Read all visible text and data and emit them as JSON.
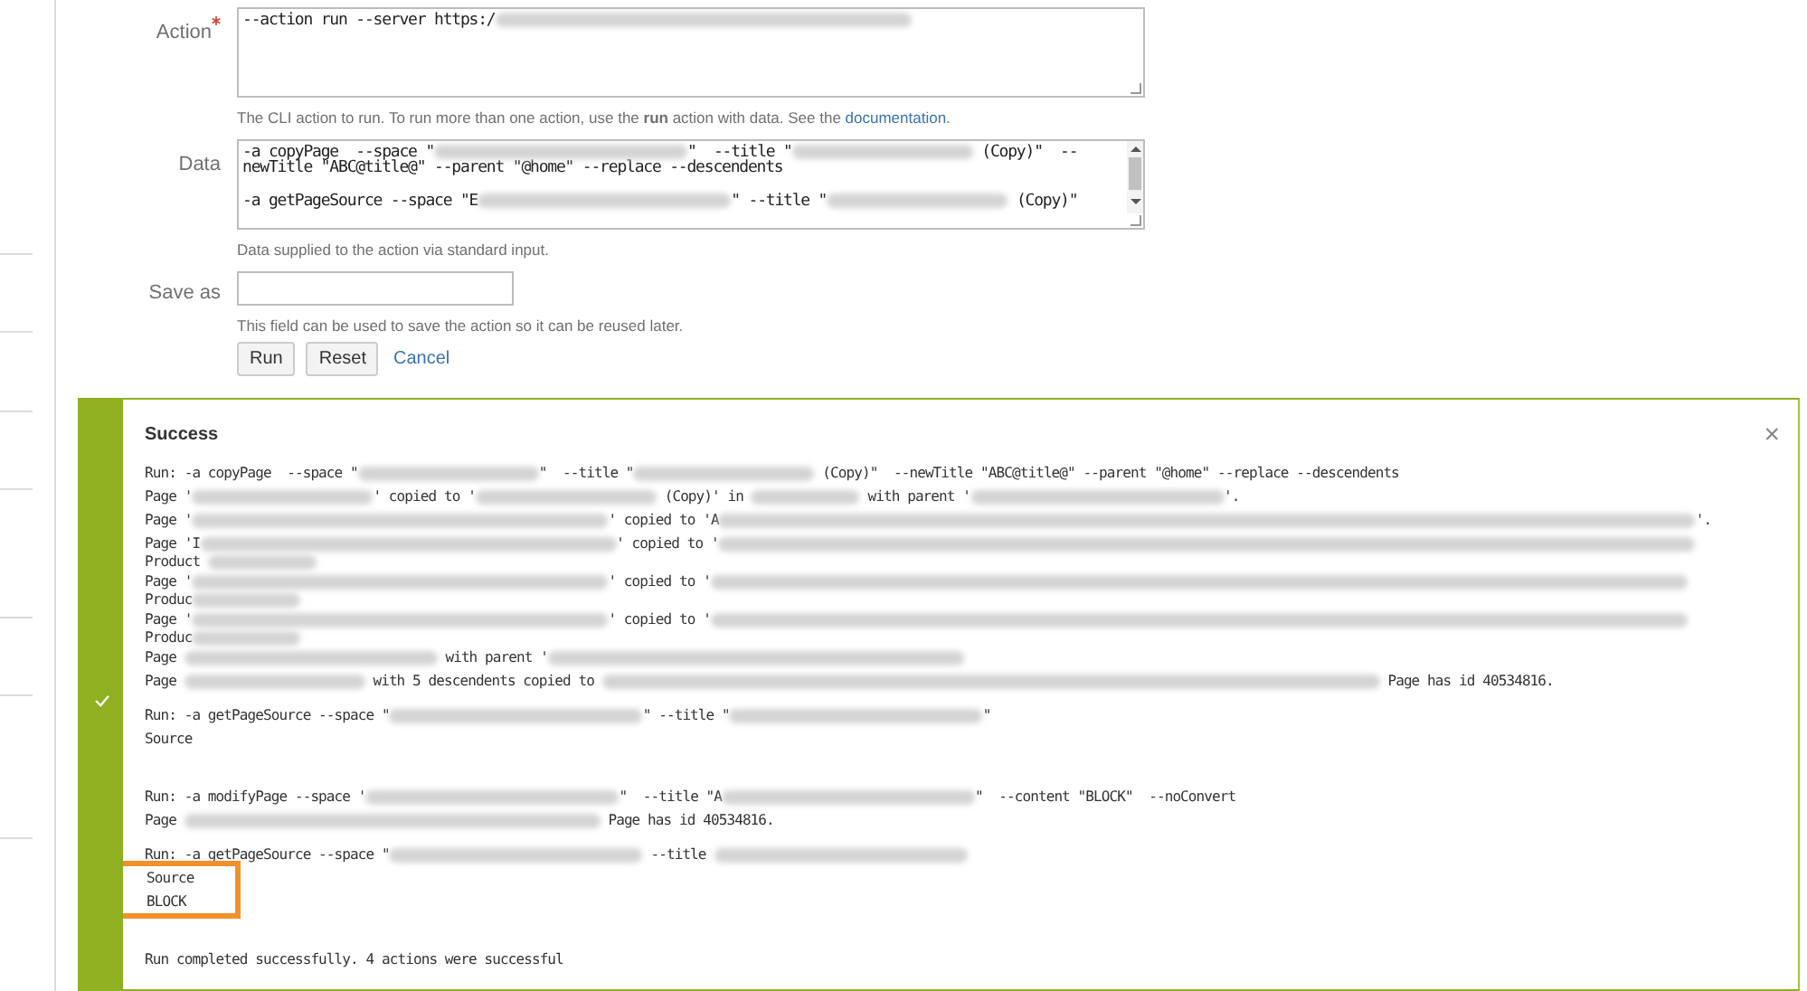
{
  "form": {
    "fields": [
      {
        "kind": "textarea",
        "label": "Action",
        "required": true,
        "lines": [
          {
            "segments": [
              "--action run --server https:/",
              {
                "kind": "blur-xl"
              }
            ]
          }
        ],
        "hint": "The CLI action to run. To run more than one action, use the **run** action with data. See the ",
        "hint_link": "documentation",
        "hint_end": "."
      },
      {
        "kind": "textarea",
        "label": "Data",
        "required": false,
        "scrollbar": true,
        "lines": [
          {
            "segments": [
              "-a copyPage  --space \"",
              {
                "kind": "blur-l"
              },
              "\"  --title \"",
              {
                "kind": "blur-m"
              },
              " (Copy)\"  --"
            ]
          },
          {
            "segments": [
              "newTitle \"ABC@title@\" --parent \"@home\" --replace --descendents"
            ]
          },
          {
            "kind": "blank"
          },
          {
            "segments": [
              "-a getPageSource --space \"E",
              {
                "kind": "blur-l"
              },
              "\" --title \"",
              {
                "kind": "blur-m"
              },
              " (Copy)\""
            ]
          }
        ],
        "hint": "Data supplied to the action via standard input."
      },
      {
        "kind": "input",
        "label": "Save as",
        "required": false,
        "hint": "This field can be used to save the action so it can be reused later."
      }
    ],
    "buttons": [
      {
        "kind": "button",
        "label": "Run"
      },
      {
        "kind": "button",
        "label": "Reset"
      },
      {
        "kind": "link",
        "label": "Cancel"
      }
    ]
  },
  "result": {
    "kind": "success",
    "title": "Success",
    "close": "×",
    "blocks": [
      {
        "lines": [
          {
            "segments": [
              "Run: -a copyPage  --space \"",
              {
                "kind": "blur-m"
              },
              "\"  --title \"",
              {
                "kind": "blur-m"
              },
              " (Copy)\"  --newTitle \"ABC@title@\" --parent \"@home\" --replace --descendents"
            ]
          },
          {
            "segments": [
              "Page '",
              {
                "kind": "blur-m"
              },
              "' copied to '",
              {
                "kind": "blur-m"
              },
              " (Copy)' in ",
              {
                "kind": "blur-s"
              },
              " with parent '",
              {
                "kind": "blur-l"
              },
              "'."
            ]
          },
          {
            "segments": [
              "Page '",
              {
                "kind": "blur-xl"
              },
              "' copied to 'A",
              {
                "kind": "blur-max"
              },
              "'."
            ]
          },
          {
            "segments": [
              "Page 'I",
              {
                "kind": "blur-xl"
              },
              "' copied to '",
              {
                "kind": "blur-max"
              }
            ],
            "wrap": [
              "Product ",
              {
                "kind": "blur-s"
              }
            ]
          },
          {
            "segments": [
              "Page '",
              {
                "kind": "blur-xl"
              },
              "' copied to '",
              {
                "kind": "blur-max"
              }
            ],
            "wrap": [
              "Produc",
              {
                "kind": "blur-s"
              }
            ]
          },
          {
            "segments": [
              "Page '",
              {
                "kind": "blur-xl"
              },
              "' copied to '",
              {
                "kind": "blur-max"
              }
            ],
            "wrap": [
              "Produc",
              {
                "kind": "blur-s"
              }
            ]
          },
          {
            "segments": [
              "Page ",
              {
                "kind": "blur-l"
              },
              " with parent '",
              {
                "kind": "blur-xl"
              }
            ]
          },
          {
            "segments": [
              "Page ",
              {
                "kind": "blur-m"
              },
              " with 5 descendents copied to ",
              {
                "kind": "blur-xxxl"
              },
              " Page has id 40534816."
            ]
          }
        ]
      },
      {
        "lines": [
          {
            "segments": [
              "Run: -a getPageSource --space \"",
              {
                "kind": "blur-l"
              },
              "\" --title \"",
              {
                "kind": "blur-l"
              },
              "\""
            ]
          },
          {
            "segments": [
              "Source"
            ]
          },
          {
            "kind": "blank"
          }
        ]
      },
      {
        "lines": [
          {
            "segments": [
              "Run: -a modifyPage --space '",
              {
                "kind": "blur-l"
              },
              "\"  --title \"A",
              {
                "kind": "blur-l"
              },
              "\"  --content \"BLOCK\"  --noConvert"
            ]
          },
          {
            "segments": [
              "Page ",
              {
                "kind": "blur-xl"
              },
              " Page has id 40534816."
            ]
          }
        ]
      },
      {
        "lines": [
          {
            "segments": [
              "Run: -a getPageSource --space \"",
              {
                "kind": "blur-l"
              },
              " --title ",
              {
                "kind": "blur-l"
              }
            ]
          },
          {
            "segments": [
              "Source"
            ],
            "highlighted": true
          },
          {
            "segments": [
              "BLOCK"
            ],
            "highlighted": true
          },
          {
            "kind": "blank"
          }
        ]
      },
      {
        "lines": [
          {
            "segments": [
              "Run completed successfully. 4 actions were successful"
            ]
          }
        ]
      }
    ]
  }
}
